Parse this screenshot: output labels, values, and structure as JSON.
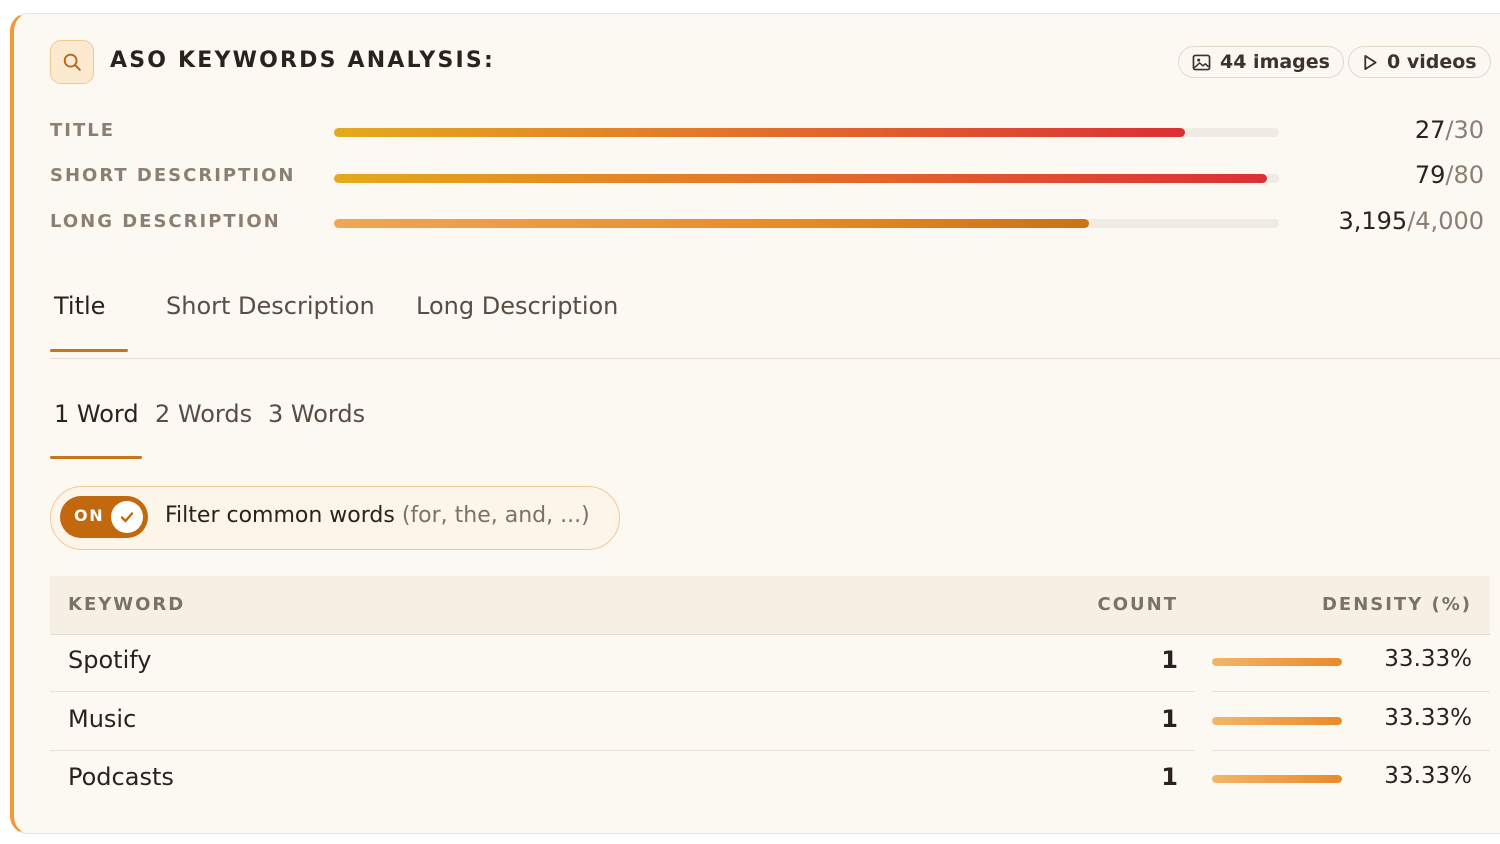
{
  "header": {
    "title": "ASO KEYWORDS ANALYSIS:",
    "images_label": "44 images",
    "videos_label": "0 videos"
  },
  "metrics": [
    {
      "label": "TITLE",
      "value": "27",
      "max": "/30",
      "fraction": 0.9
    },
    {
      "label": "SHORT DESCRIPTION",
      "value": "79",
      "max": "/80",
      "fraction": 0.9875
    },
    {
      "label": "LONG DESCRIPTION",
      "value": "3,195",
      "max": "/4,000",
      "fraction": 0.799
    }
  ],
  "tabs": [
    "Title",
    "Short Description",
    "Long Description"
  ],
  "word_tabs": [
    "1 Word",
    "2 Words",
    "3 Words"
  ],
  "filter": {
    "toggle_text": "ON",
    "label": "Filter common words",
    "hint": "(for, the, and, ...)"
  },
  "table": {
    "headers": {
      "keyword": "KEYWORD",
      "count": "COUNT",
      "density": "DENSITY (%)"
    },
    "rows": [
      {
        "keyword": "Spotify",
        "count": "1",
        "density": "33.33%",
        "density_fraction": 1.0
      },
      {
        "keyword": "Music",
        "count": "1",
        "density": "33.33%",
        "density_fraction": 1.0
      },
      {
        "keyword": "Podcasts",
        "count": "1",
        "density": "33.33%",
        "density_fraction": 1.0
      }
    ]
  },
  "colors": {
    "accent": "#c2680f",
    "card_background": "#fcf8f2",
    "bar_hot_start": "#e3aa1d",
    "bar_hot_end": "#dc2f35"
  },
  "icons": {
    "search": "search-icon",
    "image": "image-icon",
    "play": "play-icon",
    "check": "check-icon"
  }
}
